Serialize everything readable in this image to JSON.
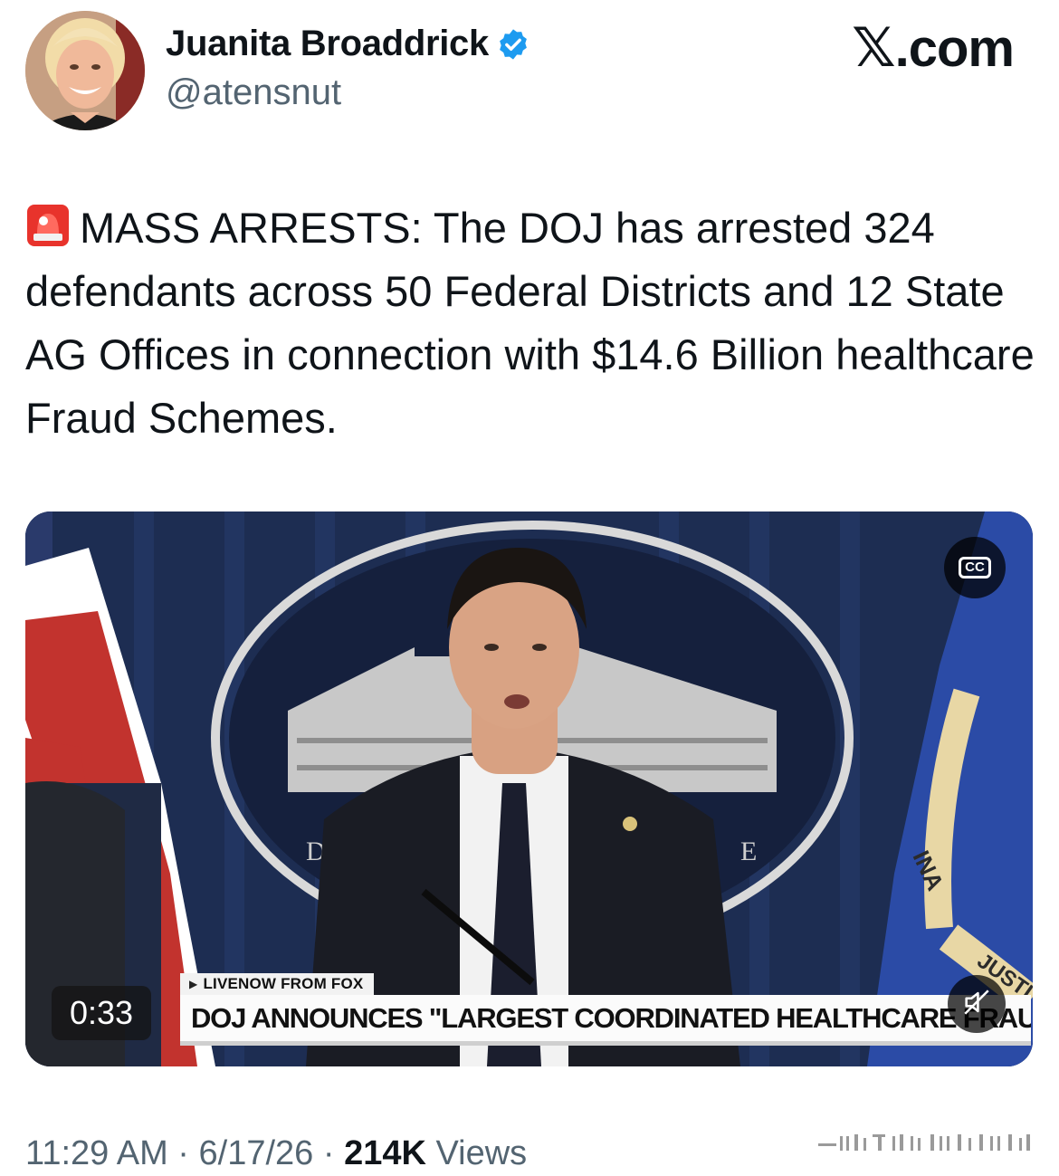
{
  "header": {
    "display_name": "Juanita Broaddrick",
    "handle": "@atensnut",
    "brand": ".com",
    "brand_logo_icon": "x-logo-icon",
    "verified": true
  },
  "tweet": {
    "emoji_icon": "rotating-light-siren-icon",
    "text": "MASS ARRESTS: The DOJ has arrested 324 defendants across 50 Federal Districts and 12 State AG Offices in connection with $14.6 Billion healthcare Fraud Schemes."
  },
  "media": {
    "type": "video",
    "timestamp": "0:33",
    "cc_label": "CC",
    "live_tag": "LIVENOW FROM FOX",
    "chyron": "DOJ ANNOUNCES \"LARGEST COORDINATED HEALTHCARE FRAUD EFFORT",
    "muted_icon": "speaker-muted-icon",
    "seal_letter_left": "D",
    "seal_letter_right": "E",
    "flag_text_1": "INA",
    "flag_text_2": "JUSTI"
  },
  "footer": {
    "time": "11:29 AM",
    "date": "6/17/26",
    "views_count": "214K",
    "views_label": "Views",
    "separator": "·"
  },
  "colors": {
    "verified_blue": "#1d9bf0",
    "secondary_text": "#536471",
    "primary_text": "#0f1419",
    "backdrop_navy": "#1d2d52"
  }
}
